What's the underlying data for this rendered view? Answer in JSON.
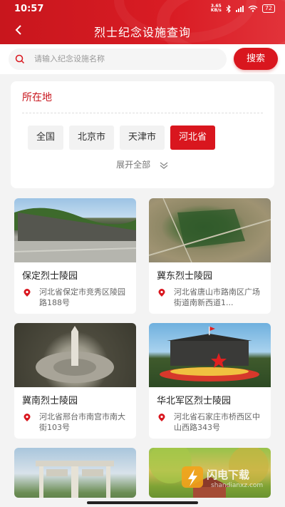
{
  "status_bar": {
    "time": "10:57",
    "net_speed_value": "3.65",
    "net_speed_unit": "KB/s",
    "battery": "72"
  },
  "header": {
    "back_icon": "chevron-left-icon",
    "title": "烈士纪念设施查询",
    "color": "#d11820"
  },
  "search": {
    "placeholder": "请输入纪念设施名称",
    "button_label": "搜索"
  },
  "location": {
    "title": "所在地",
    "options": [
      "全国",
      "北京市",
      "天津市",
      "河北省"
    ],
    "selected": "河北省",
    "expand_label": "展开全部"
  },
  "facilities": [
    {
      "name": "保定烈士陵园",
      "address": "河北省保定市竞秀区陵园路188号"
    },
    {
      "name": "冀东烈士陵园",
      "address": "河北省唐山市路南区广场街道南新西道1..."
    },
    {
      "name": "冀南烈士陵园",
      "address": "河北省邢台市南宫市南大街103号"
    },
    {
      "name": "华北军区烈士陵园",
      "address": "河北省石家庄市桥西区中山西路343号"
    },
    {
      "name": "",
      "address": ""
    },
    {
      "name": "",
      "address": ""
    }
  ],
  "watermark": {
    "text": "闪电下载",
    "sub": "shandianxz.com"
  }
}
